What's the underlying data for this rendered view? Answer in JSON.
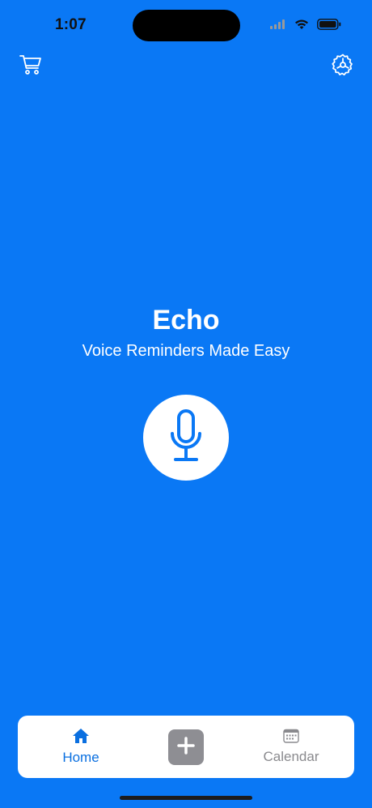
{
  "status_bar": {
    "time": "1:07"
  },
  "top_bar": {
    "cart_icon": "cart-icon",
    "settings_icon": "gear-icon"
  },
  "hero": {
    "title": "Echo",
    "subtitle": "Voice Reminders Made Easy",
    "record_icon": "microphone-icon"
  },
  "tab_bar": {
    "home_label": "Home",
    "calendar_label": "Calendar",
    "add_icon": "plus-icon",
    "active_tab": "Home"
  },
  "colors": {
    "background": "#0A78F5",
    "accent": "#0A6FE0",
    "inactive": "#8A8A8E",
    "add_button": "#8E8E93"
  }
}
